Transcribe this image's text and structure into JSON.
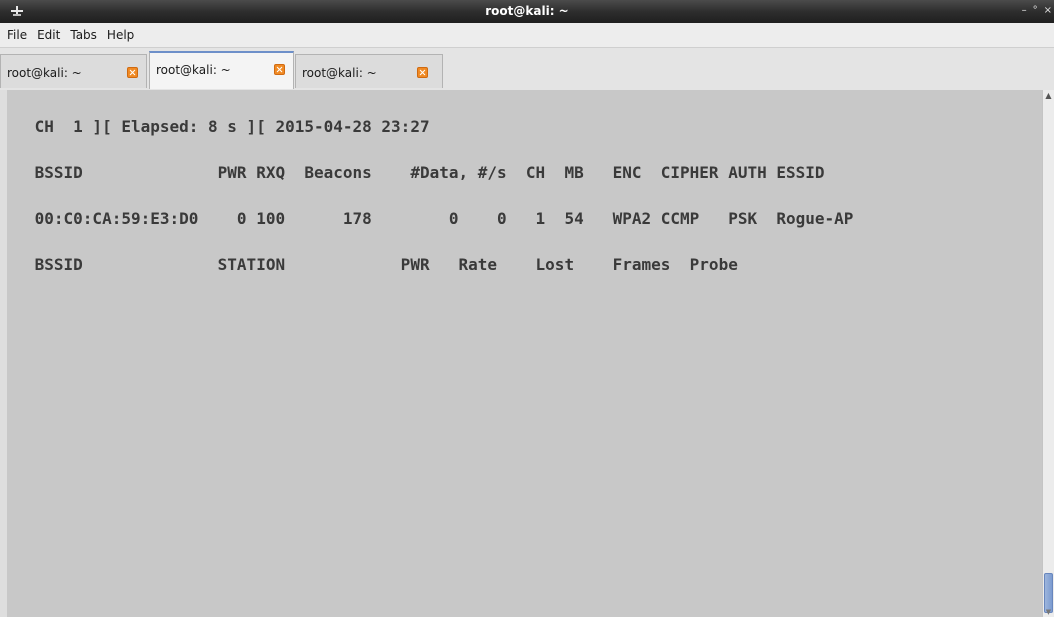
{
  "window": {
    "title": "root@kali: ~",
    "minimize_glyph": "–",
    "maximize_glyph": "°",
    "close_glyph": "×"
  },
  "menu": [
    "File",
    "Edit",
    "Tabs",
    "Help"
  ],
  "tabs": [
    {
      "label": "root@kali: ~",
      "active": false
    },
    {
      "label": "root@kali: ~",
      "active": true
    },
    {
      "label": "root@kali: ~",
      "active": false
    }
  ],
  "terminal": {
    "lines": [
      " CH  1 ][ Elapsed: 8 s ][ 2015-04-28 23:27",
      " BSSID              PWR RXQ  Beacons    #Data, #/s  CH  MB   ENC  CIPHER AUTH ESSID",
      " 00:C0:CA:59:E3:D0    0 100      178        0    0   1  54   WPA2 CCMP   PSK  Rogue-AP",
      " BSSID              STATION            PWR   Rate    Lost    Frames  Probe"
    ]
  },
  "colors": {
    "terminal_bg": "#c8c8c8",
    "terminal_fg": "#3a3a3a",
    "active_tab_accent": "#6d8fc9",
    "close_icon": "#f08a24"
  }
}
